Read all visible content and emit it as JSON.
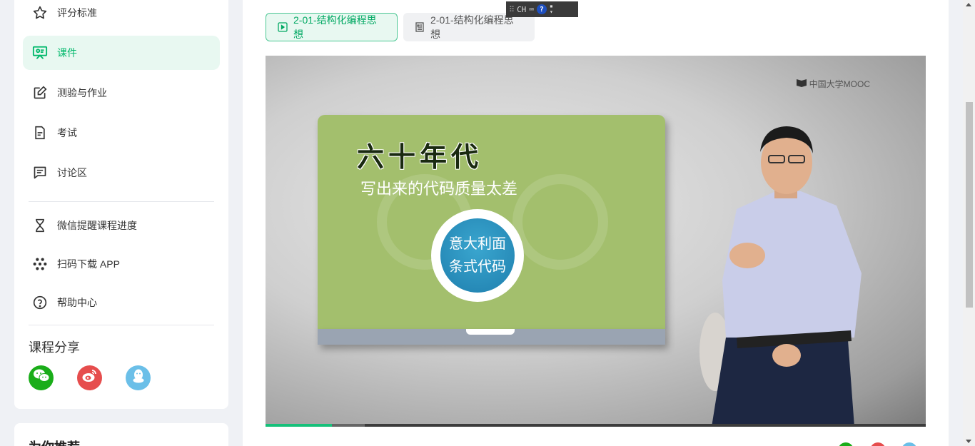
{
  "sidebar": {
    "items": [
      {
        "label": "评分标准",
        "icon": "star-icon"
      },
      {
        "label": "课件",
        "icon": "presentation-icon",
        "active": true
      },
      {
        "label": "测验与作业",
        "icon": "edit-icon"
      },
      {
        "label": "考试",
        "icon": "document-icon"
      },
      {
        "label": "讨论区",
        "icon": "chat-icon"
      }
    ],
    "tools": [
      {
        "label": "微信提醒课程进度",
        "icon": "hourglass-icon"
      },
      {
        "label": "扫码下载 APP",
        "icon": "app-icon"
      },
      {
        "label": "帮助中心",
        "icon": "help-icon"
      }
    ],
    "share_title": "课程分享",
    "share": [
      {
        "name": "wechat",
        "color": "#1aad19"
      },
      {
        "name": "weibo",
        "color": "#e6162d"
      },
      {
        "name": "qq",
        "color": "#4cb0e8"
      }
    ]
  },
  "recommend": {
    "title": "为你推荐"
  },
  "tabs": [
    {
      "label": "2-01-结构化编程思想",
      "icon": "play-icon",
      "active": true
    },
    {
      "label": "2-01-结构化编程思想",
      "icon": "doc-icon"
    }
  ],
  "ime": {
    "label": "CH"
  },
  "video": {
    "watermark": "中国大学MOOC",
    "slide_heading": "六十年代",
    "slide_subheading": "写出来的代码质量太差",
    "circle_line1": "意大利面",
    "circle_line2": "条式代码",
    "progress": 0.1,
    "buffered": 0.15,
    "colors": {
      "accent": "#16c07a",
      "slide": "#a3bf6d",
      "circle": "#2a8fbd"
    }
  }
}
